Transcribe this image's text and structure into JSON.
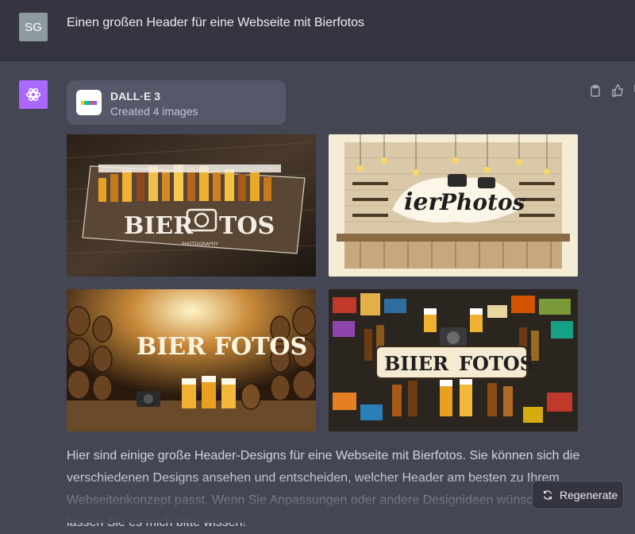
{
  "user": {
    "initials": "SG",
    "message": "Einen großen Header für eine Webseite mit Bierfotos"
  },
  "assistant": {
    "avatar_icon": "openai-logo-icon",
    "avatar_color": "#ab68ff",
    "tool_card": {
      "title": "DALL·E 3",
      "subtitle": "Created 4 images",
      "logo_colors": [
        "#f5c518",
        "#19c37d",
        "#10a3e0",
        "#e8513a",
        "#8b5cf6"
      ]
    },
    "actions": [
      "clipboard-icon",
      "thumbs-up-icon",
      "thumbs-down-icon"
    ],
    "images": [
      {
        "title": "BIER",
        "title2": "TOS",
        "caption": "PHOTOGRAPHY",
        "style": "dark wooden plank with beer glasses and camera"
      },
      {
        "title": "ier",
        "title2": "Photos",
        "style": "cream bar interior with hanging bulbs and cameras"
      },
      {
        "title": "BIER FOTOS",
        "style": "brewery cellar with barrels, camera and beer glasses"
      },
      {
        "title": "BIIER",
        "title2": "FOTOS",
        "style": "collage of beer bottles and labels with camera"
      }
    ],
    "response_lines": [
      "Hier sind einige große Header-Designs für eine Webseite mit Bierfotos. Sie können sich die",
      "verschiedenen Designs ansehen und entscheiden, welcher Header am besten zu Ihrem",
      "Webseitenkonzept passt. Wenn Sie Anpassungen oder andere Designideen wünschen,",
      "lassen Sie es mich bitte wissen!"
    ]
  },
  "regenerate": {
    "label": "Regenerate",
    "icon": "refresh-icon"
  }
}
